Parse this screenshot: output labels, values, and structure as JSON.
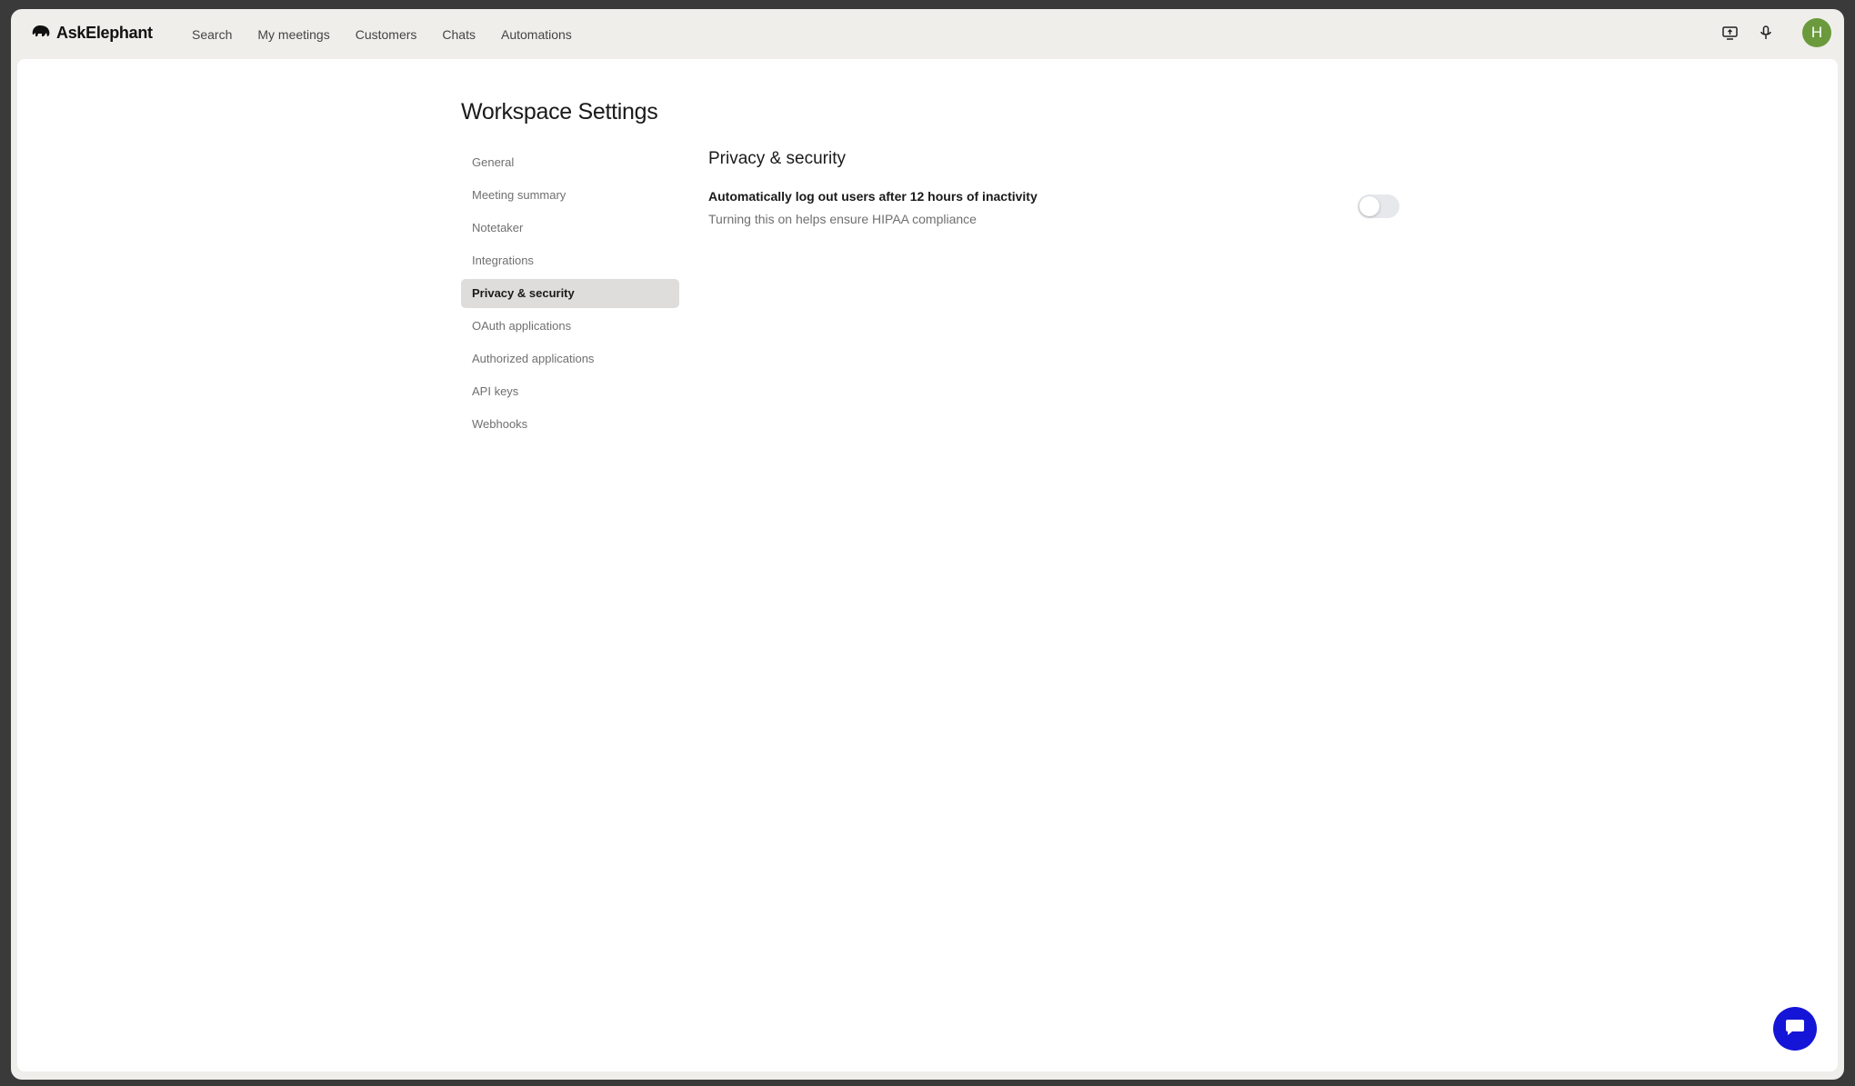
{
  "app": {
    "name": "AskElephant"
  },
  "nav": {
    "items": [
      {
        "label": "Search"
      },
      {
        "label": "My meetings"
      },
      {
        "label": "Customers"
      },
      {
        "label": "Chats"
      },
      {
        "label": "Automations"
      }
    ]
  },
  "user": {
    "initial": "H",
    "avatar_color": "#6a9a3c"
  },
  "page": {
    "title": "Workspace Settings"
  },
  "sidebar": {
    "items": [
      {
        "label": "General",
        "active": false
      },
      {
        "label": "Meeting summary",
        "active": false
      },
      {
        "label": "Notetaker",
        "active": false
      },
      {
        "label": "Integrations",
        "active": false
      },
      {
        "label": "Privacy & security",
        "active": true
      },
      {
        "label": "OAuth applications",
        "active": false
      },
      {
        "label": "Authorized applications",
        "active": false
      },
      {
        "label": "API keys",
        "active": false
      },
      {
        "label": "Webhooks",
        "active": false
      }
    ]
  },
  "panel": {
    "title": "Privacy & security",
    "setting": {
      "label": "Automatically log out users after 12 hours of inactivity",
      "description": "Turning this on helps ensure HIPAA compliance",
      "enabled": false
    }
  },
  "icons": {
    "logo": "elephant-icon",
    "screen": "screen-share-icon",
    "mic": "microphone-icon",
    "chat": "chat-bubble-icon"
  },
  "colors": {
    "chat_fab": "#1515d8",
    "active_item_bg": "#dedddb"
  }
}
